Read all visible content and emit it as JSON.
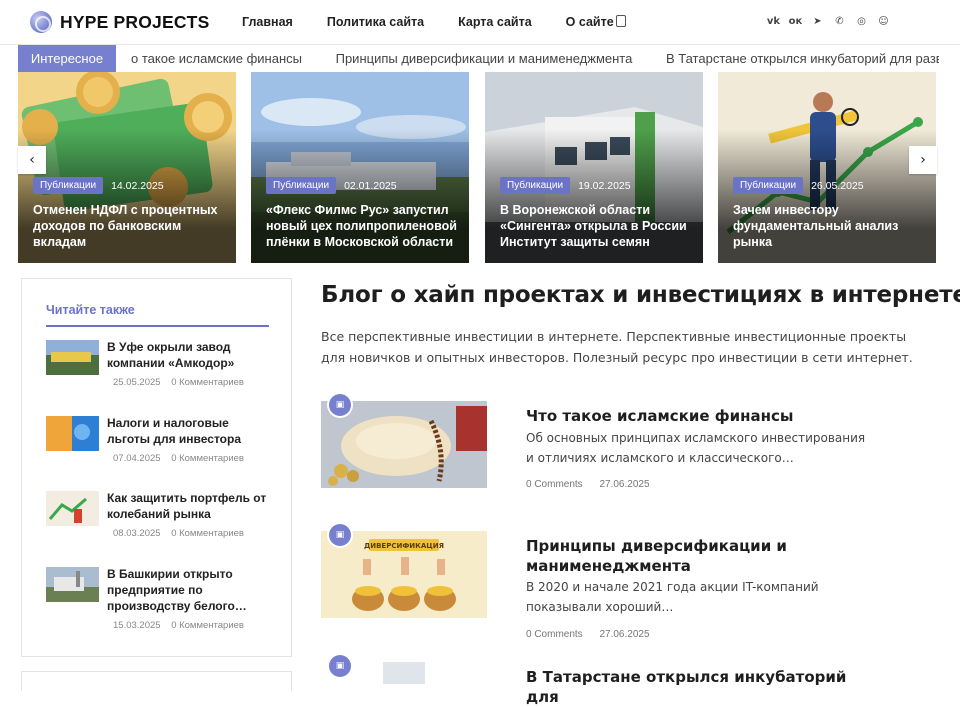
{
  "header": {
    "logo_text": "HYPE PROJECTS",
    "nav": [
      "Главная",
      "Политика сайта",
      "Карта сайта",
      "О сайте"
    ],
    "socials": [
      "vk-icon",
      "odnoklassniki-icon",
      "telegram-icon",
      "phone-icon",
      "whatsapp-icon",
      "chat-icon"
    ],
    "social_glyphs": [
      "vk",
      "ок",
      "➤",
      "✆",
      "◎",
      "☺"
    ],
    "accent": "#7680cf"
  },
  "ticker": {
    "label": "Интересное",
    "items": [
      "о такое исламские финансы",
      "Принципы диверсификации и манименеджмента",
      "В Татарстане открылся инкубаторий для разведения и"
    ]
  },
  "slider": {
    "slides": [
      {
        "category": "Публикации",
        "date": "14.02.2025",
        "title": "Отменен НДФЛ с процентных доходов по банковским вкладам"
      },
      {
        "category": "Публикации",
        "date": "02.01.2025",
        "title": "«Флекс Филмс Рус» запустил новый цех полипропиленовой плёнки в Московской области"
      },
      {
        "category": "Публикации",
        "date": "19.02.2025",
        "title": "В Воронежской области «Сингента» открыла в России Институт защиты семян"
      },
      {
        "category": "Публикации",
        "date": "26.05.2025",
        "title": "Зачем инвестору фундаментальный анализ рынка"
      }
    ],
    "prev": "‹",
    "next": "›"
  },
  "sidebar": {
    "heading": "Читайте также",
    "items": [
      {
        "title": "В Уфе окрыли завод компании «Амкодор»",
        "date": "25.05.2025",
        "comments": "0 Комментариев"
      },
      {
        "title": "Налоги и налоговые льготы для инвестора",
        "date": "07.04.2025",
        "comments": "0 Комментариев"
      },
      {
        "title": "Как защитить портфель от колебаний рынка",
        "date": "08.03.2025",
        "comments": "0 Комментариев"
      },
      {
        "title": "В Башкирии открыто предприятие по производству белого…",
        "date": "15.03.2025",
        "comments": "0 Комментариев"
      }
    ]
  },
  "main": {
    "title": "Блог о хайп проектах и инвестициях в интернете",
    "description": "Все перспективные инвестиции в интернете. Перспективные инвестиционные проекты для новичков и опытных инвесторов. Полезный ресурс про инвестиции в сети интернет.",
    "posts": [
      {
        "title": "Что такое исламские финансы",
        "excerpt": "Об основных принципах исламского инвестирования и отличиях исламского и классического…",
        "comments": "0 Comments",
        "date": "27.06.2025"
      },
      {
        "title": "Принципы диверсификации и манименеджмента",
        "excerpt": "В 2020 и начале 2021 года акции IT-компаний показывали хороший…",
        "comments": "0 Comments",
        "date": "27.06.2025",
        "image_caption": "ДИВЕРСИФИКАЦИЯ"
      },
      {
        "title": "В Татарстане открылся инкубаторий для"
      }
    ]
  }
}
